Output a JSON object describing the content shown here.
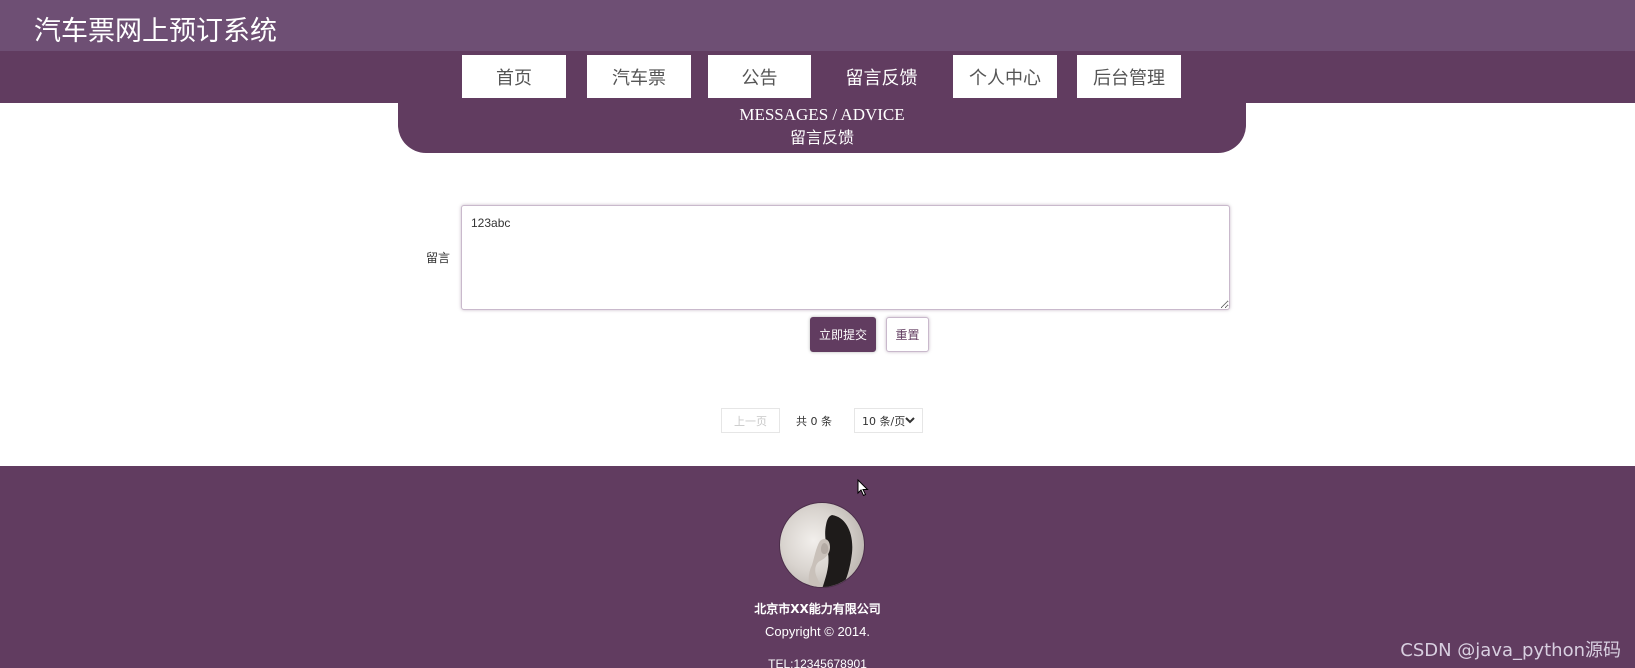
{
  "header": {
    "site_title": "汽车票网上预订系统"
  },
  "nav": {
    "items": [
      {
        "label": "首页"
      },
      {
        "label": "汽车票"
      },
      {
        "label": "公告"
      },
      {
        "label": "留言反馈"
      },
      {
        "label": "个人中心"
      },
      {
        "label": "后台管理"
      }
    ],
    "active_index": 3
  },
  "banner": {
    "title_en": "MESSAGES / ADVICE",
    "title_cn": "留言反馈"
  },
  "form": {
    "label": "留言",
    "message_value": "123abc",
    "submit_label": "立即提交",
    "reset_label": "重置"
  },
  "pagination": {
    "prev_label": "上一页",
    "total_text": "共 0 条",
    "page_size_label": "10 条/页"
  },
  "footer": {
    "company": "北京市XX能力有限公司",
    "copyright": "Copyright © 2014.",
    "tel": "TEL:12345678901"
  },
  "watermark": "CSDN @java_python源码",
  "colors": {
    "primary": "#613c60",
    "topbar": "#6e4f74",
    "white": "#ffffff"
  },
  "icons": {
    "select_arrow": "chevron-down-icon",
    "cursor": "mouse-cursor-icon"
  }
}
